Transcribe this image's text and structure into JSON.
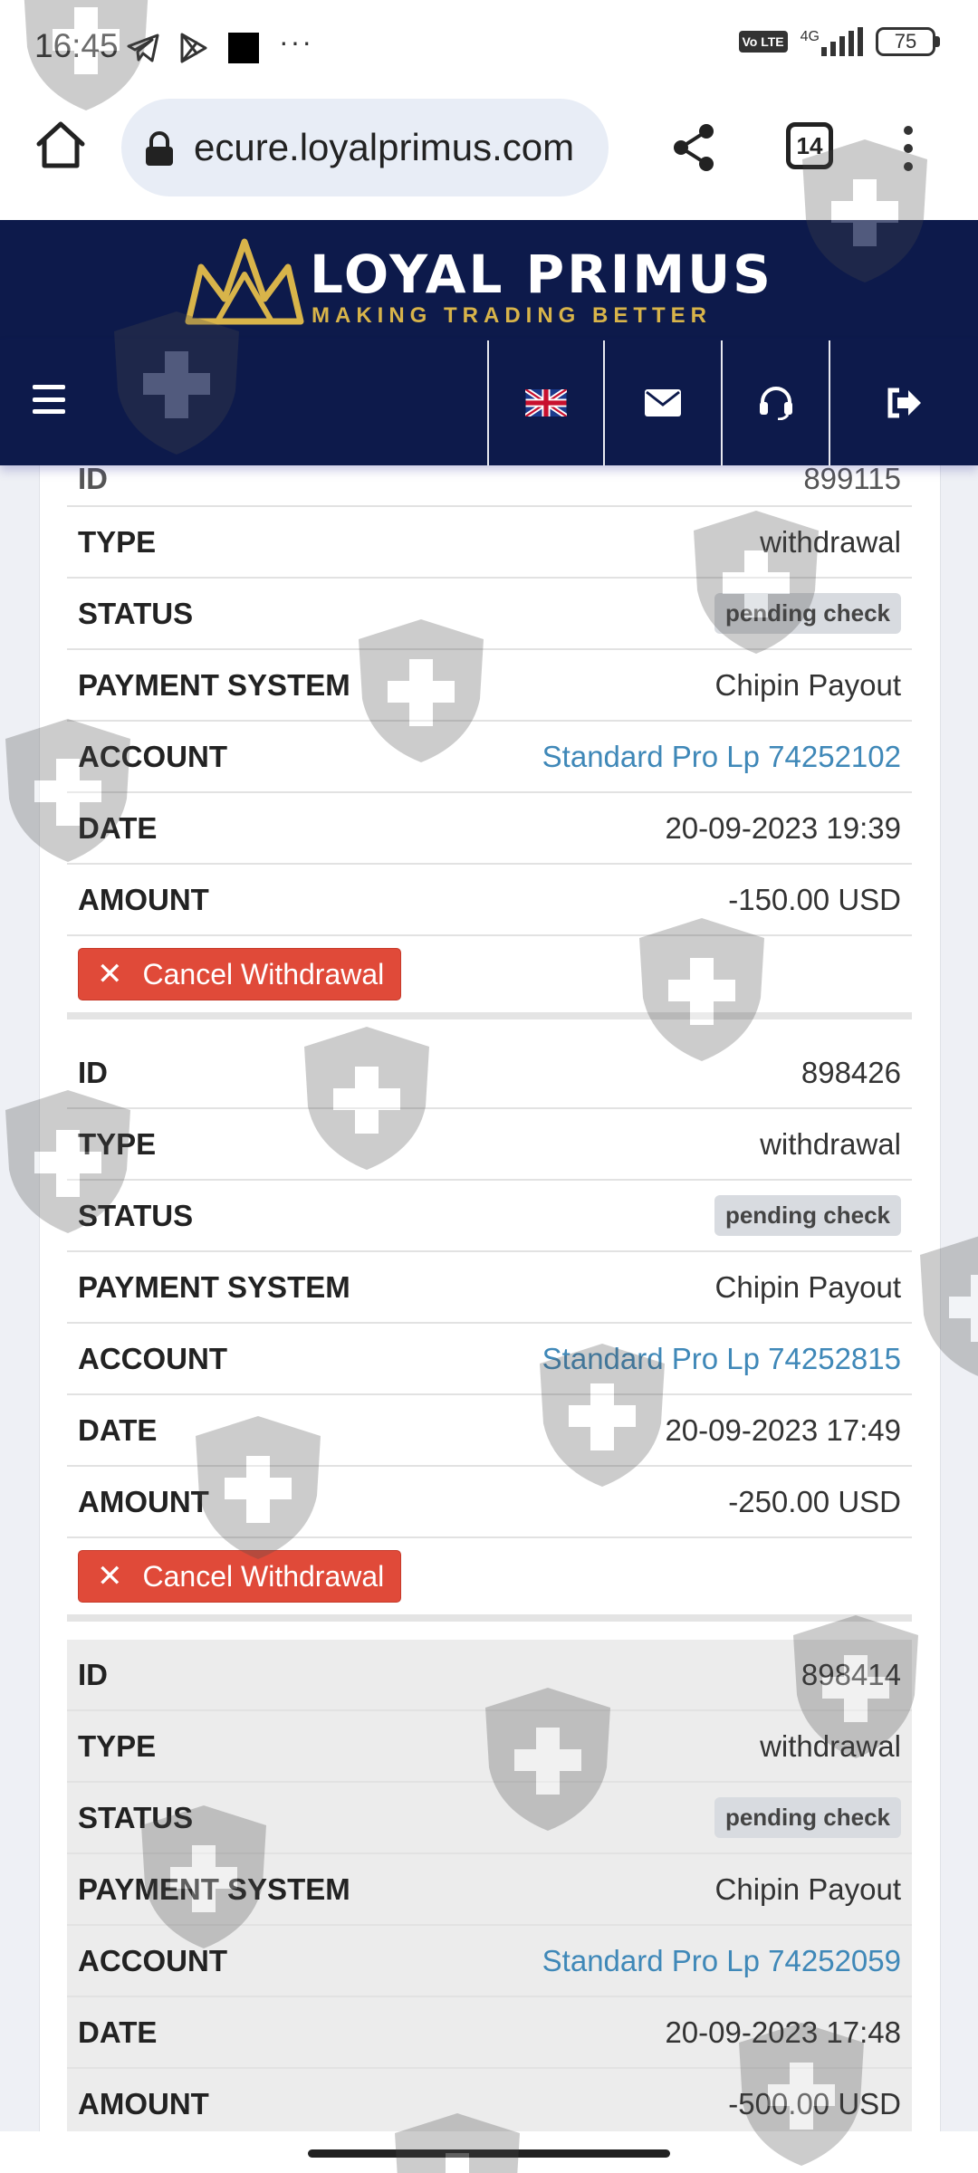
{
  "status_bar": {
    "time": "16:45",
    "network": "4G",
    "lte": "Vo LTE",
    "battery": "75"
  },
  "browser": {
    "url": "ecure.loyalprimus.com",
    "tab_count": "14"
  },
  "site": {
    "brand": "LOYAL PRIMUS",
    "tagline": "MAKING TRADING BETTER"
  },
  "records": [
    {
      "partial_id": "899115",
      "rows": [
        {
          "label": "TYPE",
          "value": "withdrawal"
        },
        {
          "label": "STATUS",
          "value": "pending check"
        },
        {
          "label": "PAYMENT SYSTEM",
          "value": "Chipin Payout"
        },
        {
          "label": "ACCOUNT",
          "value": "Standard Pro Lp 74252102"
        },
        {
          "label": "DATE",
          "value": "20-09-2023 19:39"
        },
        {
          "label": "AMOUNT",
          "value": "-150.00 USD"
        }
      ],
      "action": "Cancel Withdrawal"
    },
    {
      "rows": [
        {
          "label": "ID",
          "value": "898426"
        },
        {
          "label": "TYPE",
          "value": "withdrawal"
        },
        {
          "label": "STATUS",
          "value": "pending check"
        },
        {
          "label": "PAYMENT SYSTEM",
          "value": "Chipin Payout"
        },
        {
          "label": "ACCOUNT",
          "value": "Standard Pro Lp 74252815"
        },
        {
          "label": "DATE",
          "value": "20-09-2023 17:49"
        },
        {
          "label": "AMOUNT",
          "value": "-250.00 USD"
        }
      ],
      "action": "Cancel Withdrawal"
    },
    {
      "rows": [
        {
          "label": "ID",
          "value": "898414"
        },
        {
          "label": "TYPE",
          "value": "withdrawal"
        },
        {
          "label": "STATUS",
          "value": "pending check"
        },
        {
          "label": "PAYMENT SYSTEM",
          "value": "Chipin Payout"
        },
        {
          "label": "ACCOUNT",
          "value": "Standard Pro Lp 74252059"
        },
        {
          "label": "DATE",
          "value": "20-09-2023 17:48"
        },
        {
          "label": "AMOUNT",
          "value": "-500.00 USD"
        }
      ]
    }
  ],
  "colors": {
    "header_bg": "#0d1a4b",
    "accent_gold": "#d8b44a",
    "link": "#3f88b8",
    "danger": "#e04a39"
  },
  "icons": {
    "nav": [
      "uk-flag-icon",
      "envelope-icon",
      "headset-icon",
      "logout-icon"
    ],
    "watermark": "shield-plus-icon"
  }
}
